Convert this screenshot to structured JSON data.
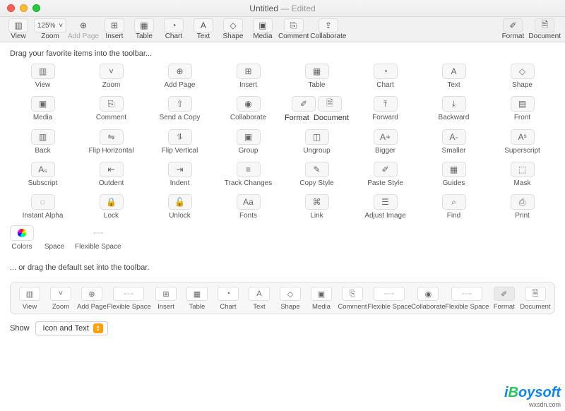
{
  "titlebar": {
    "title": "Untitled",
    "state": "Edited"
  },
  "toolbar": [
    {
      "label": "View"
    },
    {
      "label": "Zoom",
      "value": "125%"
    },
    {
      "label": "Add Page"
    },
    {
      "label": "Insert"
    },
    {
      "label": "Table"
    },
    {
      "label": "Chart"
    },
    {
      "label": "Text"
    },
    {
      "label": "Shape"
    },
    {
      "label": "Media"
    },
    {
      "label": "Comment"
    },
    {
      "label": "Collaborate"
    },
    {
      "label": "Format"
    },
    {
      "label": "Document"
    }
  ],
  "sheet": {
    "prompt_top": "Drag your favorite items into the toolbar...",
    "prompt_default": "... or drag the default set into the toolbar."
  },
  "palette": [
    "View",
    "Zoom",
    "Add Page",
    "Insert",
    "Table",
    "Chart",
    "Text",
    "Shape",
    "Media",
    "Comment",
    "Send a Copy",
    "Collaborate",
    "Format",
    "Document",
    "Forward",
    "Backward",
    "Front",
    "Back",
    "Flip Horizontal",
    "Flip Vertical",
    "Group",
    "Ungroup",
    "Bigger",
    "Smaller",
    "Superscript",
    "Subscript",
    "Outdent",
    "Indent",
    "Track Changes",
    "Copy Style",
    "Paste Style",
    "Guides",
    "Mask",
    "Instant Alpha",
    "Lock",
    "Unlock",
    "Fonts",
    "Link",
    "Adjust Image",
    "Find",
    "Print",
    "Colors",
    "Space",
    "Flexible Space"
  ],
  "defaults": [
    "View",
    "Zoom",
    "Add Page",
    "Flexible Space",
    "Insert",
    "Table",
    "Chart",
    "Text",
    "Shape",
    "Media",
    "Comment",
    "Flexible Space",
    "Collaborate",
    "Flexible Space",
    "Format",
    "Document"
  ],
  "show": {
    "label": "Show",
    "value": "Icon and Text"
  },
  "watermark": {
    "brand_rest": "oysoft",
    "domain": "wxsdn.com"
  }
}
